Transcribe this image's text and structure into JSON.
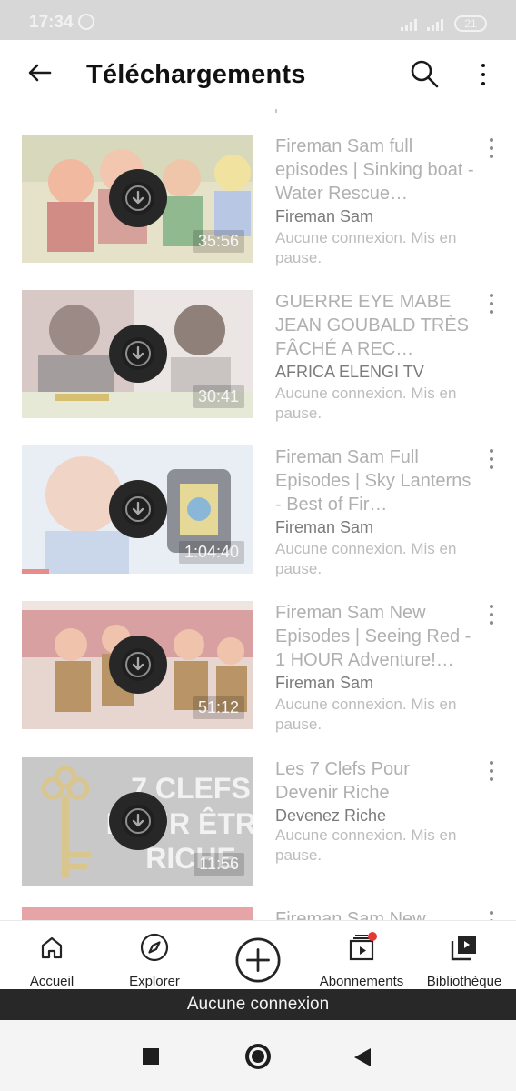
{
  "status_bar": {
    "time": "17:34",
    "battery": "21"
  },
  "header": {
    "title": "Téléchargements",
    "back_icon": "back-arrow-icon",
    "search_icon": "search-icon",
    "menu_icon": "more-vert-icon"
  },
  "videos": [
    {
      "title": "Fireman Sam full episodes | Sinking boat - Water Rescue…",
      "channel": "Fireman Sam",
      "status": "Aucune connexion. Mis en pause.",
      "duration": "35:56"
    },
    {
      "title": "GUERRE EYE MABE JEAN GOUBALD TRÈS FÂCHÉ A REC…",
      "channel": "AFRICA ELENGI TV",
      "status": "Aucune connexion. Mis en pause.",
      "duration": "30:41"
    },
    {
      "title": "Fireman Sam Full Episodes | Sky Lanterns - Best of Fir…",
      "channel": "Fireman Sam",
      "status": "Aucune connexion. Mis en pause.",
      "duration": "1:04:40"
    },
    {
      "title": "Fireman Sam New Episodes | Seeing Red - 1 HOUR Adventure!…",
      "channel": "Fireman Sam",
      "status": "Aucune connexion. Mis en pause.",
      "duration": "51:12"
    },
    {
      "title": "Les 7 Clefs Pour Devenir Riche",
      "channel": "Devenez Riche",
      "status": "Aucune connexion. Mis en pause.",
      "duration": "11:56",
      "thumb_text": "7 CLEFS POUR ÊTRE RICHE"
    },
    {
      "title": "Fireman Sam New",
      "channel": "",
      "status": "",
      "duration": ""
    }
  ],
  "bottom_nav": {
    "items": [
      {
        "label": "Accueil",
        "icon": "home-icon"
      },
      {
        "label": "Explorer",
        "icon": "compass-icon"
      },
      {
        "label": "",
        "icon": "add-circle-icon"
      },
      {
        "label": "Abonnements",
        "icon": "subscriptions-icon"
      },
      {
        "label": "Bibliothèque",
        "icon": "library-icon"
      }
    ]
  },
  "offline_message": "Aucune connexion"
}
